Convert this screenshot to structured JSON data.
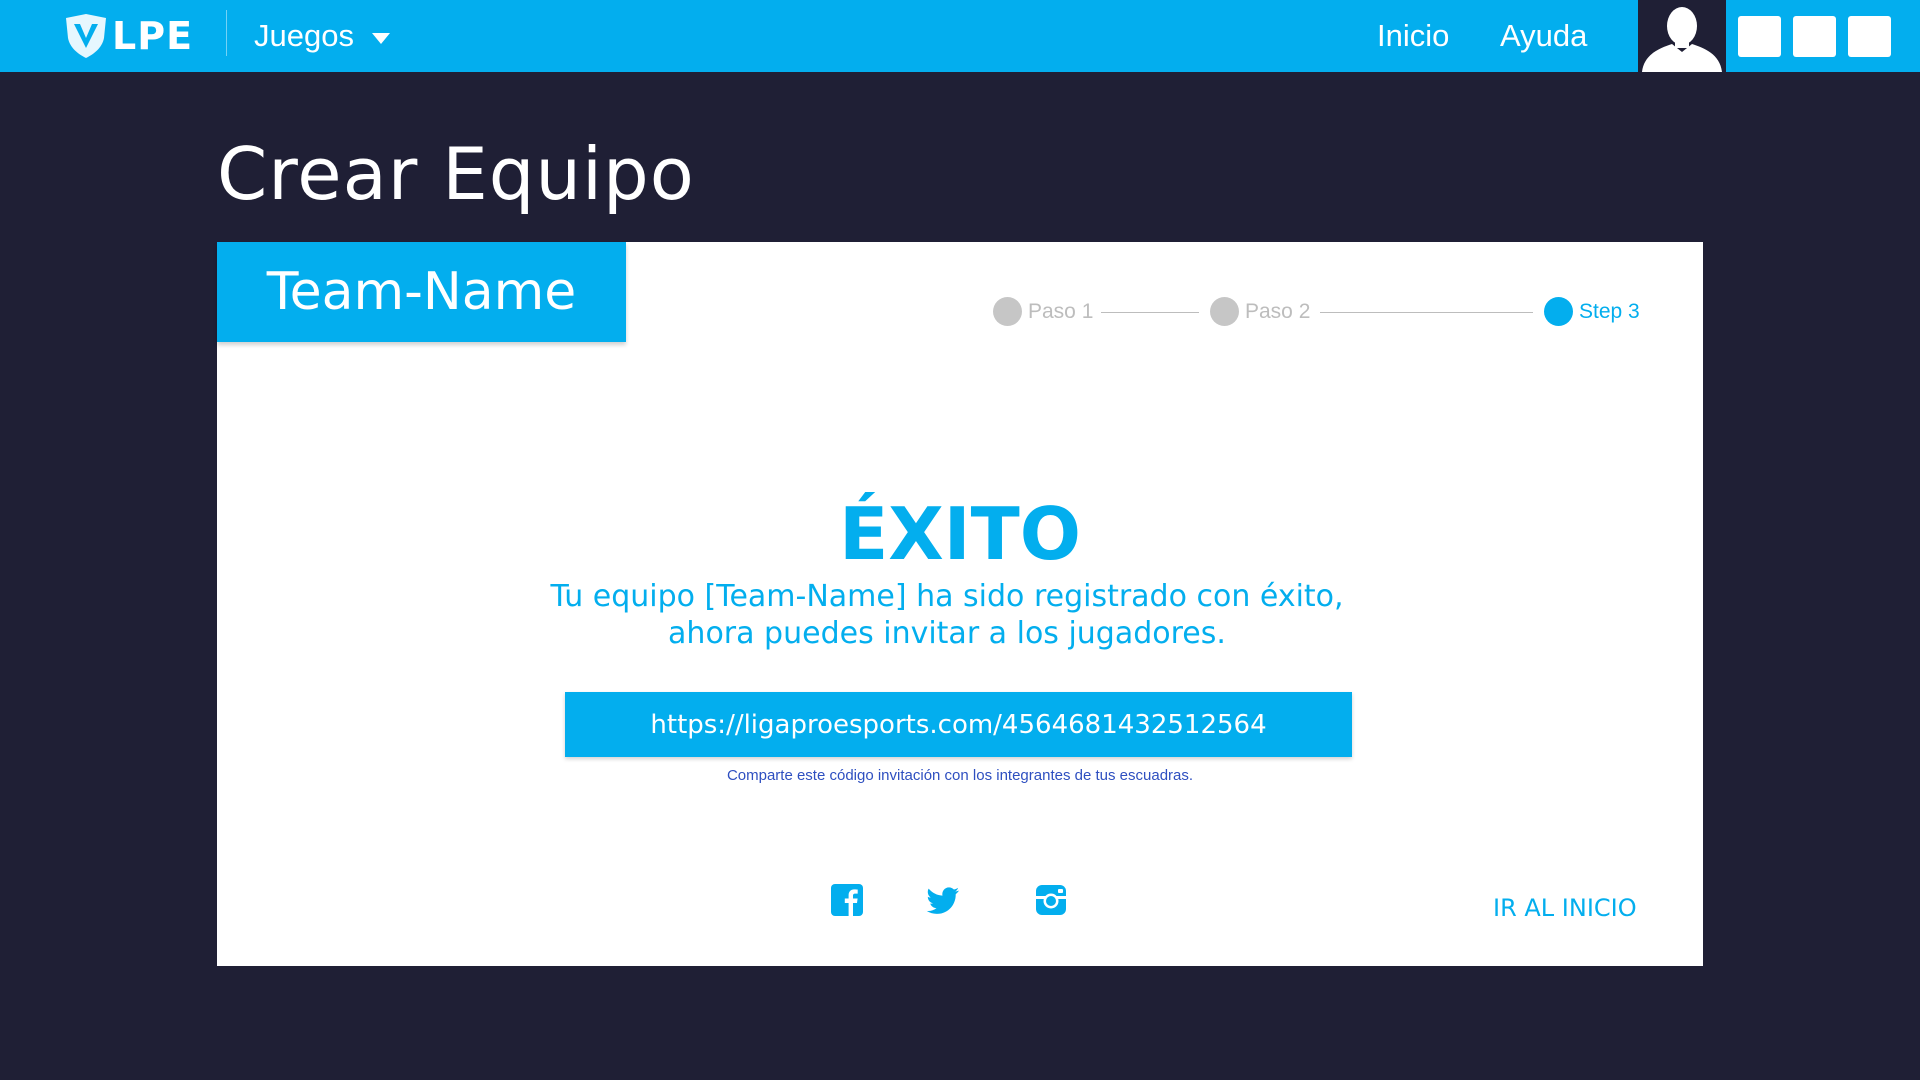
{
  "header": {
    "logo_text": "LPE",
    "games_label": "Juegos",
    "nav": {
      "home": "Inicio",
      "help": "Ayuda"
    }
  },
  "page": {
    "title": "Crear Equipo"
  },
  "card": {
    "team_name": "Team-Name",
    "steps": [
      {
        "label": "Paso 1",
        "state": "done"
      },
      {
        "label": "Paso 2",
        "state": "done"
      },
      {
        "label": "Step 3",
        "state": "active"
      }
    ],
    "success_title": "ÉXITO",
    "success_line1": "Tu equipo [Team-Name] ha sido registrado con éxito,",
    "success_line2": "ahora puedes invitar a los jugadores.",
    "invite_link": "https://ligaproesports.com/4564681432512564",
    "share_hint": "Comparte este código invitación con los integrantes de tus escuadras.",
    "go_home": "IR AL INICIO",
    "social": [
      "facebook-icon",
      "twitter-icon",
      "instagram-icon"
    ]
  },
  "colors": {
    "accent": "#03aeee",
    "background": "#1f1f35",
    "card": "#ffffff",
    "hint": "#2e4fc0",
    "step_inactive": "#c6c6c6"
  }
}
